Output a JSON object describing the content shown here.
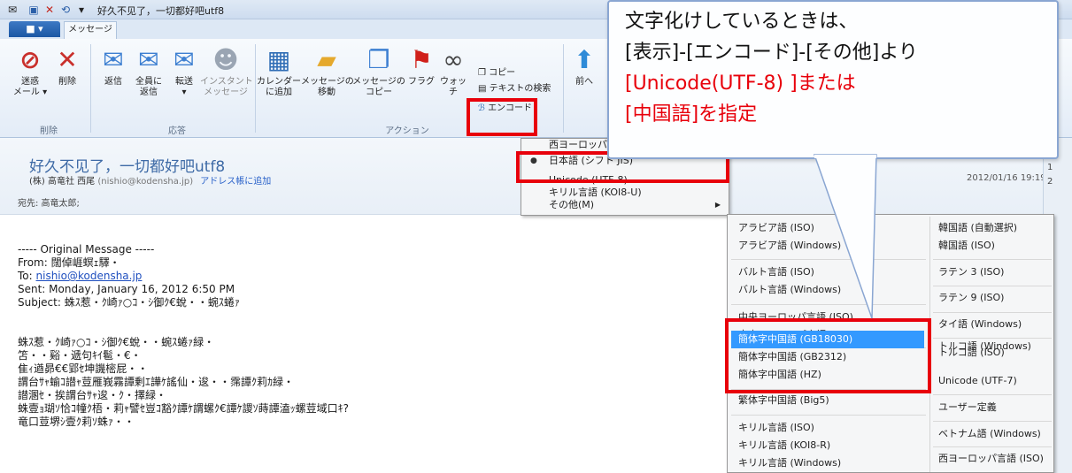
{
  "window": {
    "title": "好久不见了，一切都好吧utf8",
    "quick_access": [
      "✉",
      "▣",
      "✕",
      "⟲",
      "▾"
    ]
  },
  "ribbon": {
    "file_tab": "■ ▾",
    "tabs": [
      "メッセージ"
    ],
    "groups": {
      "delete": {
        "label": "削除",
        "buttons": [
          {
            "label": "迷惑\nメール ▾",
            "icon": "junk-icon"
          },
          {
            "label": "削除",
            "icon": "delete-icon"
          }
        ]
      },
      "respond": {
        "label": "応答",
        "buttons": [
          {
            "label": "返信",
            "icon": "reply-icon"
          },
          {
            "label": "全員に\n返信",
            "icon": "reply-all-icon"
          },
          {
            "label": "転送\n▾",
            "icon": "forward-icon"
          },
          {
            "label": "インスタント\nメッセージ",
            "icon": "instant-message-icon"
          }
        ]
      },
      "actions": {
        "label": "アクション",
        "buttons": [
          {
            "label": "カレンダー\nに追加",
            "icon": "calendar-icon"
          },
          {
            "label": "メッセージの\n移動",
            "icon": "move-folder-icon"
          },
          {
            "label": "メッセージの\nコピー",
            "icon": "copy-message-icon"
          },
          {
            "label": "フラグ",
            "icon": "flag-icon"
          },
          {
            "label": "ウォッチ",
            "icon": "watch-icon"
          }
        ],
        "small_items": [
          "コピー",
          "テキストの検索",
          "エンコード"
        ]
      },
      "nav": {
        "buttons": [
          {
            "label": "前へ",
            "icon": "up-arrow-icon"
          }
        ]
      }
    }
  },
  "message": {
    "subject": "好久不见了，一切都好吧utf8",
    "sender": "(株) 高竜社 西尾",
    "sender_email": "(nishio@kodensha.jp)",
    "add_to_address_book": "アドレス帳に追加",
    "to_line": "宛先: 高竜太郎;",
    "date": "2012/01/16 19:19",
    "body_lines": [
      "----- Original Message -----",
      "From: 闊倬崕螟ｪ驛・",
      "To: nishio@kodensha.jp",
      "Sent: Monday, January 16, 2012 6:50 PM",
      "Subject: 蛛ｽ惹・ｸ崎ｧ○ｺ・ｼ御ｸ€蛻・・蜿ｽ蜷ｧ",
      "",
      "",
      "蛛ｽ惹・ｸ崎ｧ○ｺ・ｼ御ｸ€蛻・・蜿ｽ蜷ｧ緑・",
      "笘・・谿・遞句ｷｲ髱・€・",
      "隹ｨ遒昴€€郢ｾ坤譏樒屁・・",
      "謂台ｻｬ蝓ｺ譛ｬ荳雁峩霧譚剰ｴ譁ｹ謠仙・逡・・霈譚ｸ莉ｶ緑・",
      "譛溷ｾ・挨謂台ｻｬ逡・ｸ・擇緑・",
      "蛛壹ｮ瑚ｿ恰ｺ幢ｸ梧・莉ｬ譬ｾ豈ｺ豁ｸ譚ｹ謂螺ｸ€譚ｹ謖ｿ蒔譚溘ｯ螺荳域口ｷ?",
      "竜口荳堺ｼ壹ｸ莉ｿ蛛ｧ・・"
    ]
  },
  "right_pane": {
    "items": [
      "1",
      "2"
    ]
  },
  "encoding_menu": {
    "items": [
      {
        "label": "西ヨーロッパ",
        "bullet": "",
        "arrow": ""
      },
      {
        "label": "日本語 (シフト JIS)",
        "bullet": "●",
        "arrow": ""
      },
      {
        "label": "Unicode (UTF-8)",
        "bullet": "",
        "arrow": ""
      },
      {
        "label": "キリル言語 (KOI8-U)",
        "bullet": "",
        "arrow": ""
      },
      {
        "label": "その他(M)",
        "bullet": "",
        "arrow": "▶"
      }
    ]
  },
  "submenu": {
    "left": [
      "アラビア語 (ISO)",
      "アラビア語 (Windows)",
      "バルト言語 (ISO)",
      "バルト言語 (Windows)",
      "中央ヨーロッパ言語 (ISO)",
      "中央ヨーロッパ言語 (Windows)",
      "簡体字中国語 (GB18030)",
      "簡体字中国語 (GB2312)",
      "簡体字中国語 (HZ)",
      "繁体字中国語 (Big5)",
      "キリル言語 (ISO)",
      "キリル言語 (KOI8-R)",
      "キリル言語 (Windows)"
    ],
    "right": [
      "韓国語 (自動選択)",
      "韓国語 (ISO)",
      "ラテン 3 (ISO)",
      "ラテン 9 (ISO)",
      "タイ語 (Windows)",
      "トルコ語 (ISO)",
      "トルコ語 (Windows)",
      "Unicode (UTF-7)",
      "ユーザー定義",
      "ベトナム語 (Windows)",
      "西ヨーロッパ言語 (ISO)"
    ]
  },
  "callout": {
    "line1": "文字化けしているときは、",
    "line2": "[表示]-[エンコード]-[その他]より",
    "line3": "[Unicode(UTF-8) ]または",
    "line4": "[中国語]を指定"
  },
  "colors": {
    "highlight_red": "#e8000b",
    "accent_blue": "#3399ff",
    "subject_blue": "#3e6aa6"
  }
}
